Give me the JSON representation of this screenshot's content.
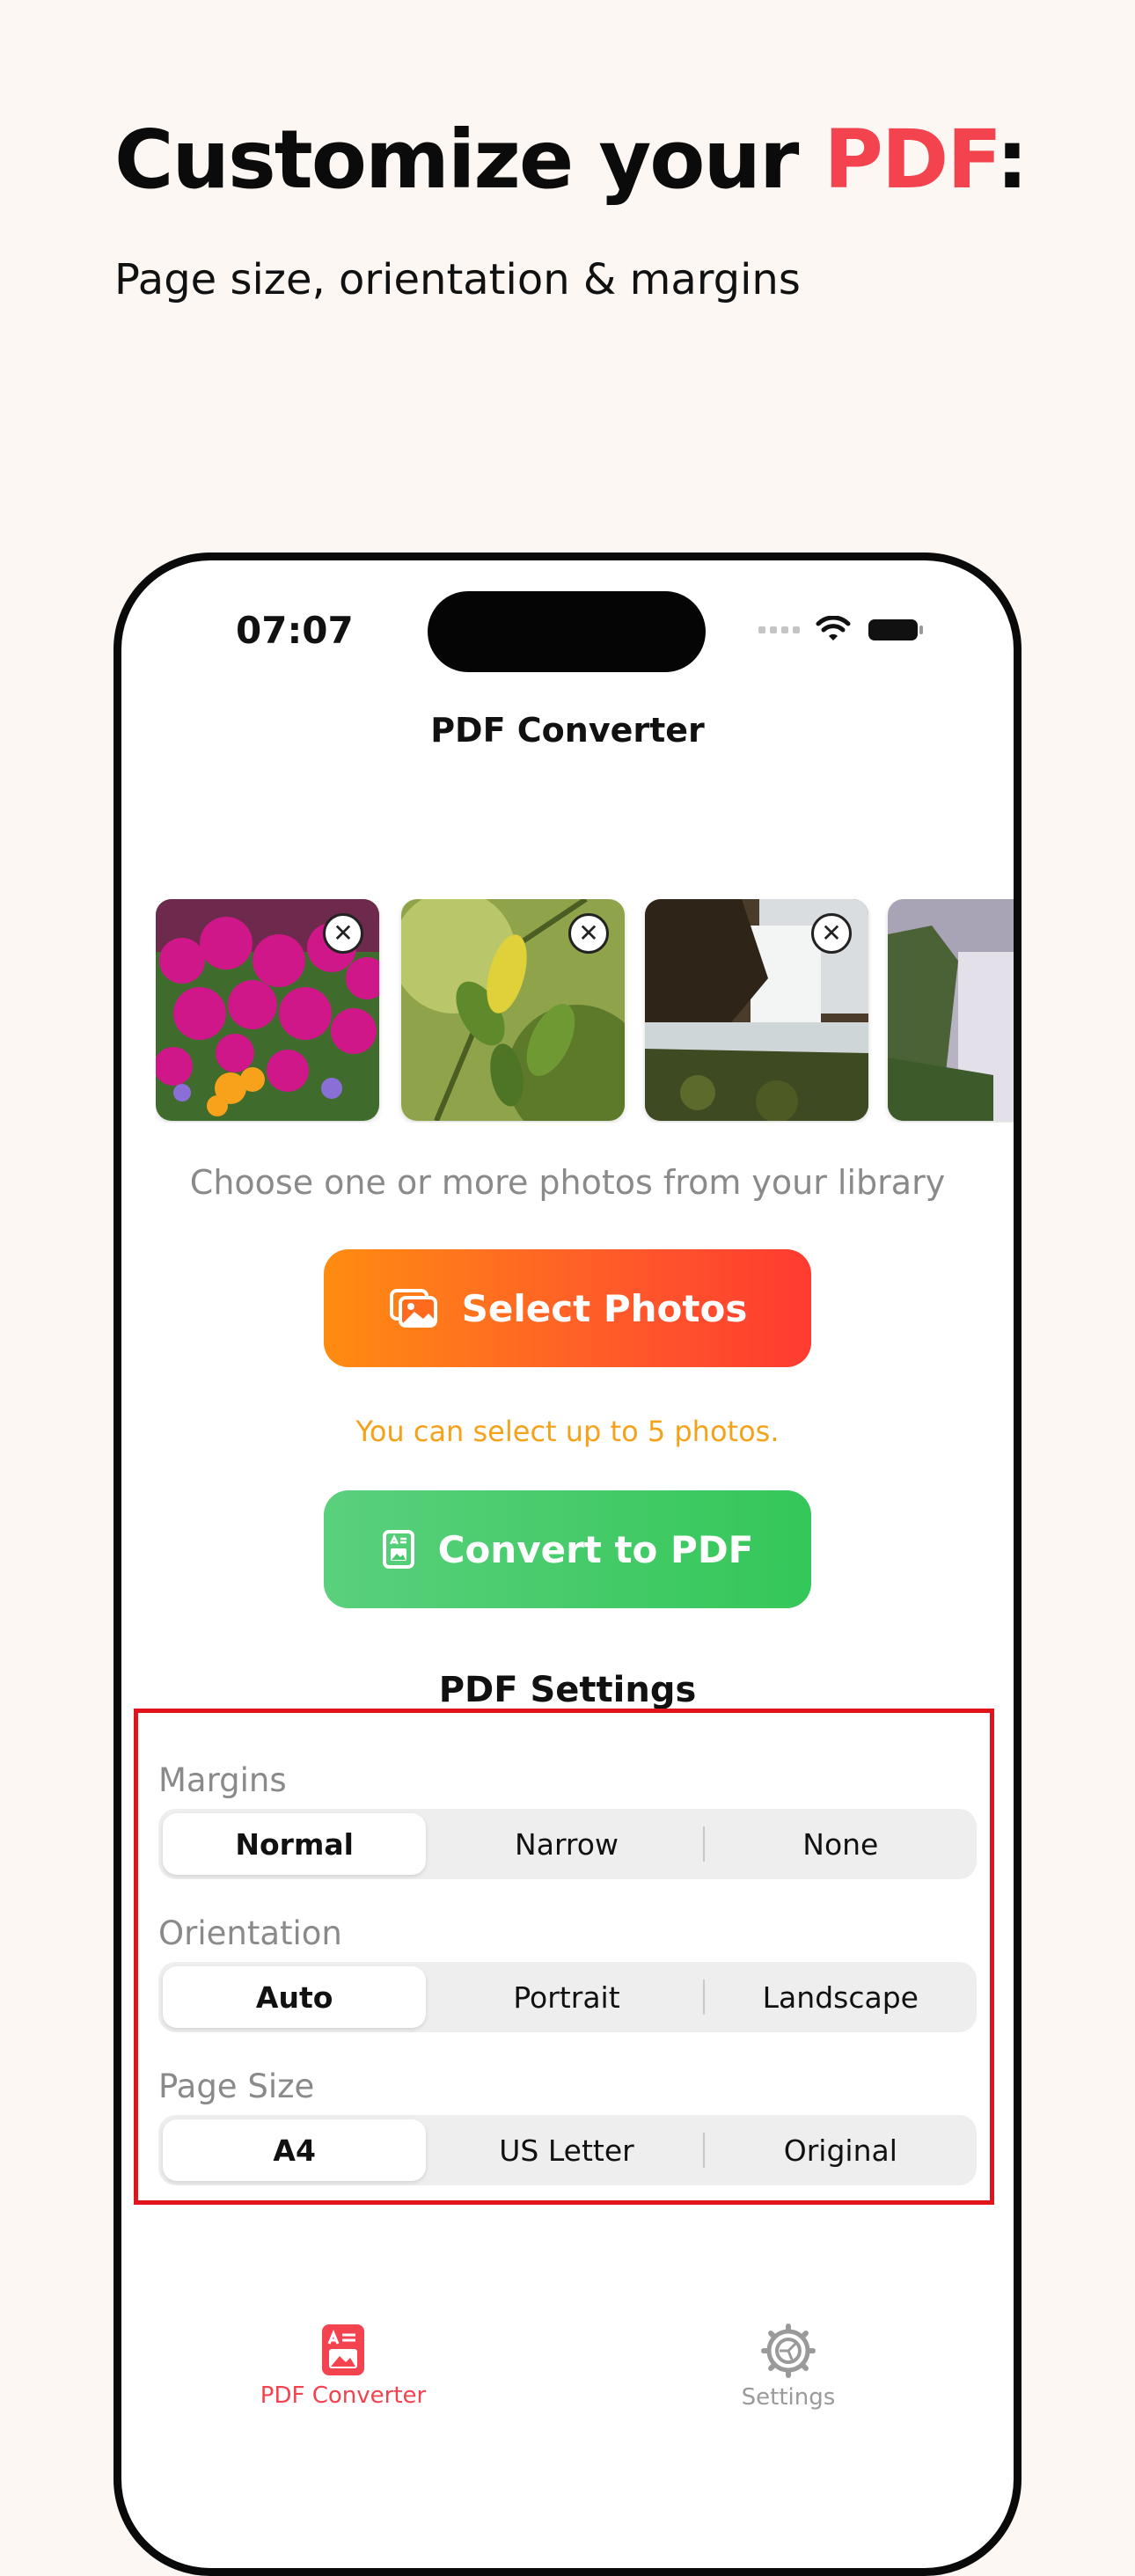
{
  "promo": {
    "headline_prefix": "Customize your ",
    "headline_accent": "PDF",
    "headline_suffix": ":",
    "subhead": "Page size, orientation & margins"
  },
  "status_bar": {
    "time": "07:07"
  },
  "nav": {
    "title": "PDF Converter"
  },
  "photos": {
    "thumbnails": [
      "flowers",
      "leaves",
      "waterfall",
      "misty-cliff"
    ],
    "hint": "Choose one or more photos from your library"
  },
  "actions": {
    "select_label": "Select Photos",
    "limit_note": "You can select up to 5 photos.",
    "convert_label": "Convert to PDF"
  },
  "settings": {
    "title": "PDF Settings",
    "margins": {
      "label": "Margins",
      "options": [
        "Normal",
        "Narrow",
        "None"
      ],
      "selected": "Normal"
    },
    "orientation": {
      "label": "Orientation",
      "options": [
        "Auto",
        "Portrait",
        "Landscape"
      ],
      "selected": "Auto"
    },
    "page_size": {
      "label": "Page Size",
      "options": [
        "A4",
        "US Letter",
        "Original"
      ],
      "selected": "A4"
    }
  },
  "tabbar": {
    "converter_label": "PDF Converter",
    "settings_label": "Settings"
  },
  "colors": {
    "accent": "#f2434f",
    "select_gradient_start": "#ff8c11",
    "select_gradient_end": "#ff3b30",
    "convert_green": "#34c759",
    "limit_note": "#f5a21b",
    "highlight_border": "#e0151b"
  }
}
